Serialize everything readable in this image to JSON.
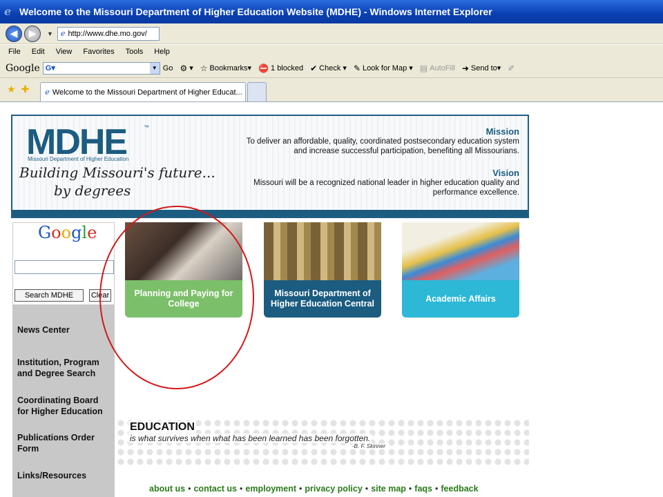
{
  "window": {
    "title": "Welcome to the Missouri Department of Higher Education Website (MDHE) - Windows Internet Explorer"
  },
  "address": {
    "url": "http://www.dhe.mo.gov/"
  },
  "menu": [
    "File",
    "Edit",
    "View",
    "Favorites",
    "Tools",
    "Help"
  ],
  "google_toolbar": {
    "logo": "Google",
    "go": "Go",
    "items": [
      {
        "icon": "star-icon",
        "label": "Bookmarks▾"
      },
      {
        "icon": "popup-blocked-icon",
        "label": "1 blocked"
      },
      {
        "icon": "spellcheck-icon",
        "label": "Check ▾"
      },
      {
        "icon": "map-icon",
        "label": "Look for Map ▾"
      },
      {
        "icon": "autofill-icon",
        "label": "AutoFill"
      },
      {
        "icon": "send-icon",
        "label": "Send to▾"
      }
    ]
  },
  "tabs": [
    {
      "label": "Welcome to the Missouri Department of Higher Educat..."
    }
  ],
  "banner": {
    "logo_text": "MDHE",
    "logo_tm": "™",
    "logo_sub": "Missouri Department of Higher Education",
    "tagline1": "Building Missouri's future...",
    "tagline2": "by degrees",
    "mission_title": "Mission",
    "mission_text": "To deliver an affordable, quality, coordinated postsecondary education system and increase successful participation, benefiting all Missourians.",
    "vision_title": "Vision",
    "vision_text": "Missouri will be a recognized national leader in higher education quality and performance excellence."
  },
  "sidebar": {
    "search_button": "Search MDHE",
    "clear_button": "Clear",
    "nav": [
      "News Center",
      "Institution, Program and Degree Search",
      "Coordinating Board for Higher Education",
      "Publications Order Form",
      "Links/Resources"
    ]
  },
  "tiles": [
    {
      "label": "Planning and Paying for College"
    },
    {
      "label": "Missouri Department of Higher Education Central"
    },
    {
      "label": "Academic Affairs"
    }
  ],
  "quote": {
    "heading": "EDUCATION",
    "text": "is what survives when what has been learned has been forgotten.",
    "author": "-B. F. Skinner"
  },
  "footer": [
    "about us",
    "contact us",
    "employment",
    "privacy policy",
    "site map",
    "faqs",
    "feedback"
  ]
}
